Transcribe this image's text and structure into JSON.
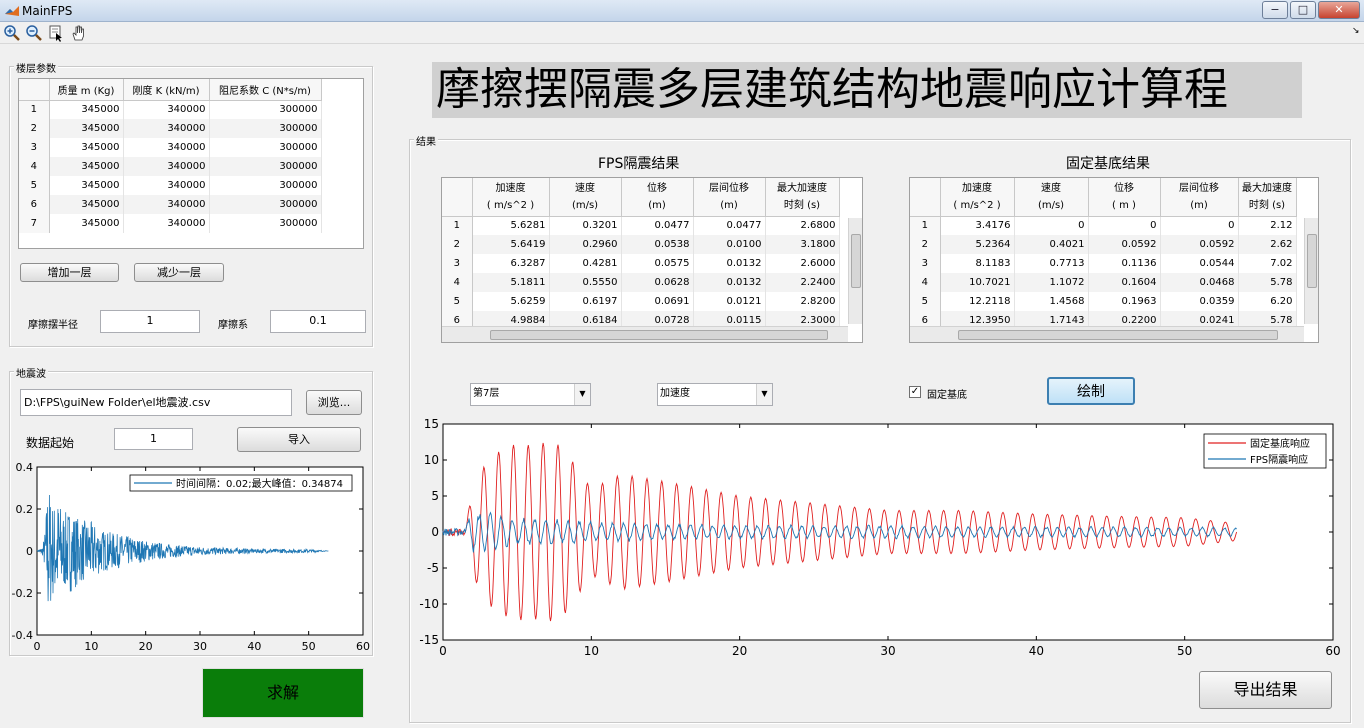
{
  "window": {
    "title": "MainFPS",
    "minimize": "−",
    "maximize": "□",
    "close": "✕"
  },
  "toolbar": {
    "icons": [
      "zoom-in-icon",
      "zoom-out-icon",
      "data-cursor-icon",
      "pan-hand-icon"
    ],
    "corner": "↘"
  },
  "app_title": "摩擦摆隔震多层建筑结构地震响应计算程",
  "floors": {
    "group_label": "楼层参数",
    "headers": [
      "质量 m (Kg)",
      "刚度 K (kN/m)",
      "阻尼系数 C (N*s/m)"
    ],
    "rows": [
      [
        "1",
        "345000",
        "340000",
        "300000"
      ],
      [
        "2",
        "345000",
        "340000",
        "300000"
      ],
      [
        "3",
        "345000",
        "340000",
        "300000"
      ],
      [
        "4",
        "345000",
        "340000",
        "300000"
      ],
      [
        "5",
        "345000",
        "340000",
        "300000"
      ],
      [
        "6",
        "345000",
        "340000",
        "300000"
      ],
      [
        "7",
        "345000",
        "340000",
        "300000"
      ]
    ],
    "add_button": "增加一层",
    "remove_button": "减少一层",
    "radius_label": "摩擦摆半径",
    "radius_value": "1",
    "friction_label": "摩擦系",
    "friction_value": "0.1"
  },
  "wave": {
    "group_label": "地震波",
    "path": "D:\\FPS\\guiNew Folder\\el地震波.csv",
    "browse_button": "浏览...",
    "start_label": "数据起始",
    "start_value": "1",
    "import_button": "导入",
    "legend": "时间间隔：0.02;最大峰值：0.34874",
    "x_ticks": [
      "0",
      "10",
      "20",
      "30",
      "40",
      "50",
      "60"
    ],
    "y_ticks": [
      "0.4",
      "0.2",
      "0",
      "-0.2",
      "-0.4"
    ]
  },
  "solve_button": "求解",
  "results": {
    "group_label": "结果",
    "fps": {
      "title": "FPS隔震结果",
      "headers": [
        [
          "加速度",
          "( m/s^2 )"
        ],
        [
          "速度",
          "(m/s)"
        ],
        [
          "位移",
          "(m)"
        ],
        [
          "层间位移",
          "(m)"
        ],
        [
          "最大加速度",
          "时刻 (s)"
        ]
      ],
      "rows": [
        [
          "1",
          "5.6281",
          "0.3201",
          "0.0477",
          "0.0477",
          "2.6800"
        ],
        [
          "2",
          "5.6419",
          "0.2960",
          "0.0538",
          "0.0100",
          "3.1800"
        ],
        [
          "3",
          "6.3287",
          "0.4281",
          "0.0575",
          "0.0132",
          "2.6000"
        ],
        [
          "4",
          "5.1811",
          "0.5550",
          "0.0628",
          "0.0132",
          "2.2400"
        ],
        [
          "5",
          "5.6259",
          "0.6197",
          "0.0691",
          "0.0121",
          "2.8200"
        ],
        [
          "6",
          "4.9884",
          "0.6184",
          "0.0728",
          "0.0115",
          "2.3000"
        ]
      ]
    },
    "fixed": {
      "title": "固定基底结果",
      "headers": [
        [
          "加速度",
          "( m/s^2 )"
        ],
        [
          "速度",
          "(m/s)"
        ],
        [
          "位移",
          "( m )"
        ],
        [
          "层间位移",
          "(m)"
        ],
        [
          "最大加速度",
          "时刻 (s)"
        ]
      ],
      "rows": [
        [
          "1",
          "3.4176",
          "0",
          "0",
          "0",
          "2.12"
        ],
        [
          "2",
          "5.2364",
          "0.4021",
          "0.0592",
          "0.0592",
          "2.62"
        ],
        [
          "3",
          "8.1183",
          "0.7713",
          "0.1136",
          "0.0544",
          "7.02"
        ],
        [
          "4",
          "10.7021",
          "1.1072",
          "0.1604",
          "0.0468",
          "5.78"
        ],
        [
          "5",
          "12.2118",
          "1.4568",
          "0.1963",
          "0.0359",
          "6.20"
        ],
        [
          "6",
          "12.3950",
          "1.7143",
          "0.2200",
          "0.0241",
          "5.78"
        ]
      ]
    },
    "floor_select": "第7层",
    "quantity_select": "加速度",
    "fixed_checkbox_label": "固定基底",
    "fixed_checked": true,
    "plot_button": "绘制",
    "export_button": "导出结果",
    "plot": {
      "legend": [
        "固定基底响应",
        "FPS隔震响应"
      ],
      "colors": {
        "fixed": "#e02020",
        "fps": "#1f77b4"
      },
      "x_ticks": [
        "0",
        "10",
        "20",
        "30",
        "40",
        "50",
        "60"
      ],
      "y_ticks": [
        "15",
        "10",
        "5",
        "0",
        "-5",
        "-10",
        "-15"
      ]
    }
  },
  "chart_data": [
    {
      "type": "line",
      "title": "",
      "xlabel": "",
      "ylabel": "",
      "xlim": [
        0,
        60
      ],
      "ylim": [
        -0.4,
        0.4
      ],
      "grid": false,
      "legend_position": "top-right",
      "series": [
        {
          "name": "时间间隔：0.02;最大峰值：0.34874",
          "x": [
            0,
            1,
            1.5,
            2,
            2.5,
            3,
            4,
            5,
            6,
            8,
            10,
            12,
            15,
            20,
            25,
            30,
            35,
            40,
            45,
            50,
            53.7
          ],
          "y": [
            0,
            0.02,
            0.1,
            0.35,
            -0.27,
            0.22,
            -0.25,
            0.18,
            -0.2,
            0.15,
            -0.14,
            0.1,
            -0.08,
            0.05,
            -0.03,
            0.02,
            -0.015,
            0.01,
            -0.01,
            0.008,
            0
          ]
        }
      ]
    },
    {
      "type": "line",
      "title": "",
      "xlabel": "",
      "ylabel": "",
      "xlim": [
        0,
        60
      ],
      "ylim": [
        -15,
        15
      ],
      "grid": false,
      "legend_position": "top-right",
      "series": [
        {
          "name": "固定基底响应",
          "x": [
            0,
            1.5,
            2,
            3,
            4,
            5,
            6,
            7,
            8,
            10,
            12,
            15,
            20,
            25,
            30,
            35,
            40,
            45,
            50,
            53.5
          ],
          "y": [
            0,
            0.5,
            -6,
            10,
            -11.5,
            12.3,
            -12,
            12.5,
            -12,
            6,
            -8,
            7,
            -5,
            4,
            -3,
            3,
            -2.5,
            2.2,
            -2,
            1.2
          ]
        },
        {
          "name": "FPS隔震响应",
          "x": [
            0,
            1.5,
            2,
            3,
            4,
            5,
            6,
            8,
            10,
            15,
            20,
            25,
            30,
            35,
            40,
            45,
            50,
            53.5
          ],
          "y": [
            0,
            1.5,
            -3,
            3,
            -2.5,
            2,
            -2,
            1.8,
            -1.5,
            1.2,
            -1,
            1,
            -1,
            0.8,
            -0.8,
            0.8,
            -0.7,
            -0.7
          ]
        }
      ]
    }
  ]
}
